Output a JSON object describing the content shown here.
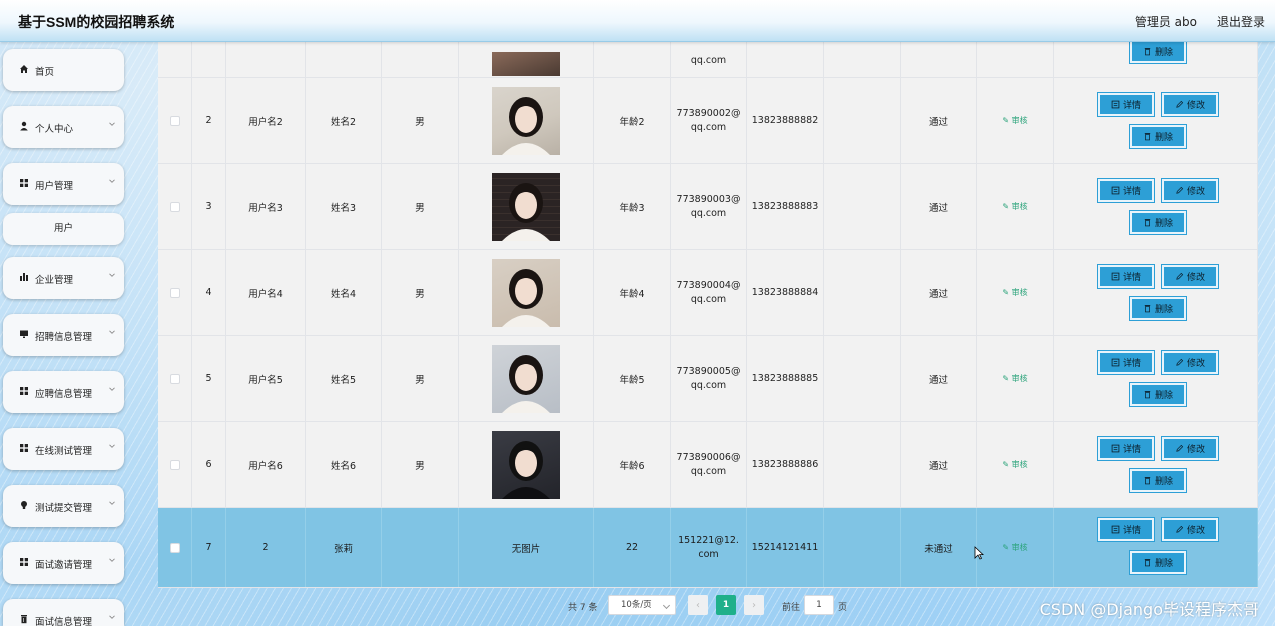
{
  "header": {
    "title": "基于SSM的校园招聘系统",
    "admin": "管理员 abo",
    "logout": "退出登录"
  },
  "sidebar": {
    "items": [
      {
        "label": "首页",
        "icon": "home-icon",
        "expandable": false
      },
      {
        "label": "个人中心",
        "icon": "person-icon",
        "expandable": true
      },
      {
        "label": "用户管理",
        "icon": "grid-icon",
        "expandable": true
      },
      {
        "label": "企业管理",
        "icon": "bar-chart-icon",
        "expandable": true
      },
      {
        "label": "招聘信息管理",
        "icon": "monitor-icon",
        "expandable": true
      },
      {
        "label": "应聘信息管理",
        "icon": "grid-icon",
        "expandable": true
      },
      {
        "label": "在线测试管理",
        "icon": "grid-icon",
        "expandable": true
      },
      {
        "label": "测试提交管理",
        "icon": "bulb-icon",
        "expandable": true
      },
      {
        "label": "面试邀请管理",
        "icon": "grid-icon",
        "expandable": true
      },
      {
        "label": "面试信息管理",
        "icon": "trash-icon",
        "expandable": true
      }
    ],
    "submenu": {
      "label": "用户"
    }
  },
  "table": {
    "partial_email_tail": "qq.com",
    "rows": [
      {
        "index": "2",
        "username": "用户名2",
        "name": "姓名2",
        "gender": "男",
        "age": "年龄2",
        "email": "773890002@qq.com",
        "phone": "13823888882",
        "status": "通过",
        "audit": "审核",
        "photo": "photo-1"
      },
      {
        "index": "3",
        "username": "用户名3",
        "name": "姓名3",
        "gender": "男",
        "age": "年龄3",
        "email": "773890003@qq.com",
        "phone": "13823888883",
        "status": "通过",
        "audit": "审核",
        "photo": "photo-2"
      },
      {
        "index": "4",
        "username": "用户名4",
        "name": "姓名4",
        "gender": "男",
        "age": "年龄4",
        "email": "773890004@qq.com",
        "phone": "13823888884",
        "status": "通过",
        "audit": "审核",
        "photo": "photo-3"
      },
      {
        "index": "5",
        "username": "用户名5",
        "name": "姓名5",
        "gender": "男",
        "age": "年龄5",
        "email": "773890005@qq.com",
        "phone": "13823888885",
        "status": "通过",
        "audit": "审核",
        "photo": "photo-4"
      },
      {
        "index": "6",
        "username": "用户名6",
        "name": "姓名6",
        "gender": "男",
        "age": "年龄6",
        "email": "773890006@qq.com",
        "phone": "13823888886",
        "status": "通过",
        "audit": "审核",
        "photo": "photo-5"
      },
      {
        "index": "7",
        "username": "2",
        "name": "张莉",
        "gender": "",
        "age": "22",
        "email": "151221@12.com",
        "phone": "15214121411",
        "status": "未通过",
        "audit": "审核",
        "photo_text": "无图片",
        "selected": true
      }
    ],
    "actions": {
      "detail": "详情",
      "edit": "修改",
      "delete": "删除"
    }
  },
  "pagination": {
    "total": "共 7 条",
    "page_size": "10条/页",
    "current": "1",
    "goto_label": "前往",
    "goto_value": "1",
    "page_suffix": "页"
  },
  "watermark": "CSDN @Django毕设程序杰哥",
  "colors": {
    "primary_button": "#2d9fd6",
    "selected_row": "#80c4e4",
    "active_page": "#1fb08a",
    "audit_text": "#2aa37a"
  }
}
